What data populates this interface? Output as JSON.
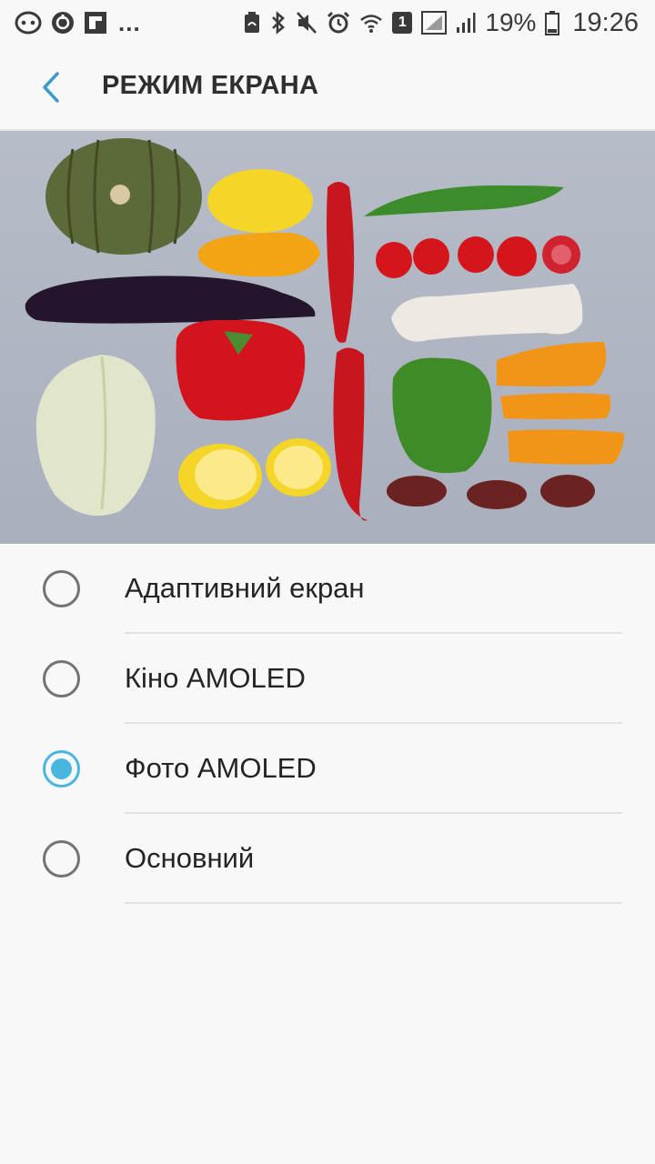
{
  "status_bar": {
    "left_icons": [
      "face-notification-icon",
      "sync-icon",
      "flipboard-icon"
    ],
    "more_indicator": "...",
    "right_icons": [
      "nfc-icon",
      "bluetooth-icon",
      "mute-icon",
      "alarm-icon",
      "wifi-icon",
      "sim-icon",
      "signal-icon",
      "signal-icon",
      "battery-icon"
    ],
    "sim_number": "1",
    "battery_percent": "19%",
    "time": "19:26"
  },
  "app_bar": {
    "title": "РЕЖИМ ЕКРАНА",
    "back_icon": "back-arrow-icon"
  },
  "preview": {
    "description_icon": "vegetables-photo"
  },
  "options": [
    {
      "label": "Адаптивний екран",
      "selected": false
    },
    {
      "label": "Кіно AMOLED",
      "selected": false
    },
    {
      "label": "Фото AMOLED",
      "selected": true
    },
    {
      "label": "Основний",
      "selected": false
    }
  ],
  "colors": {
    "accent": "#49b6e0",
    "back_arrow": "#3d9ac9",
    "background": "#f8f8f8"
  }
}
